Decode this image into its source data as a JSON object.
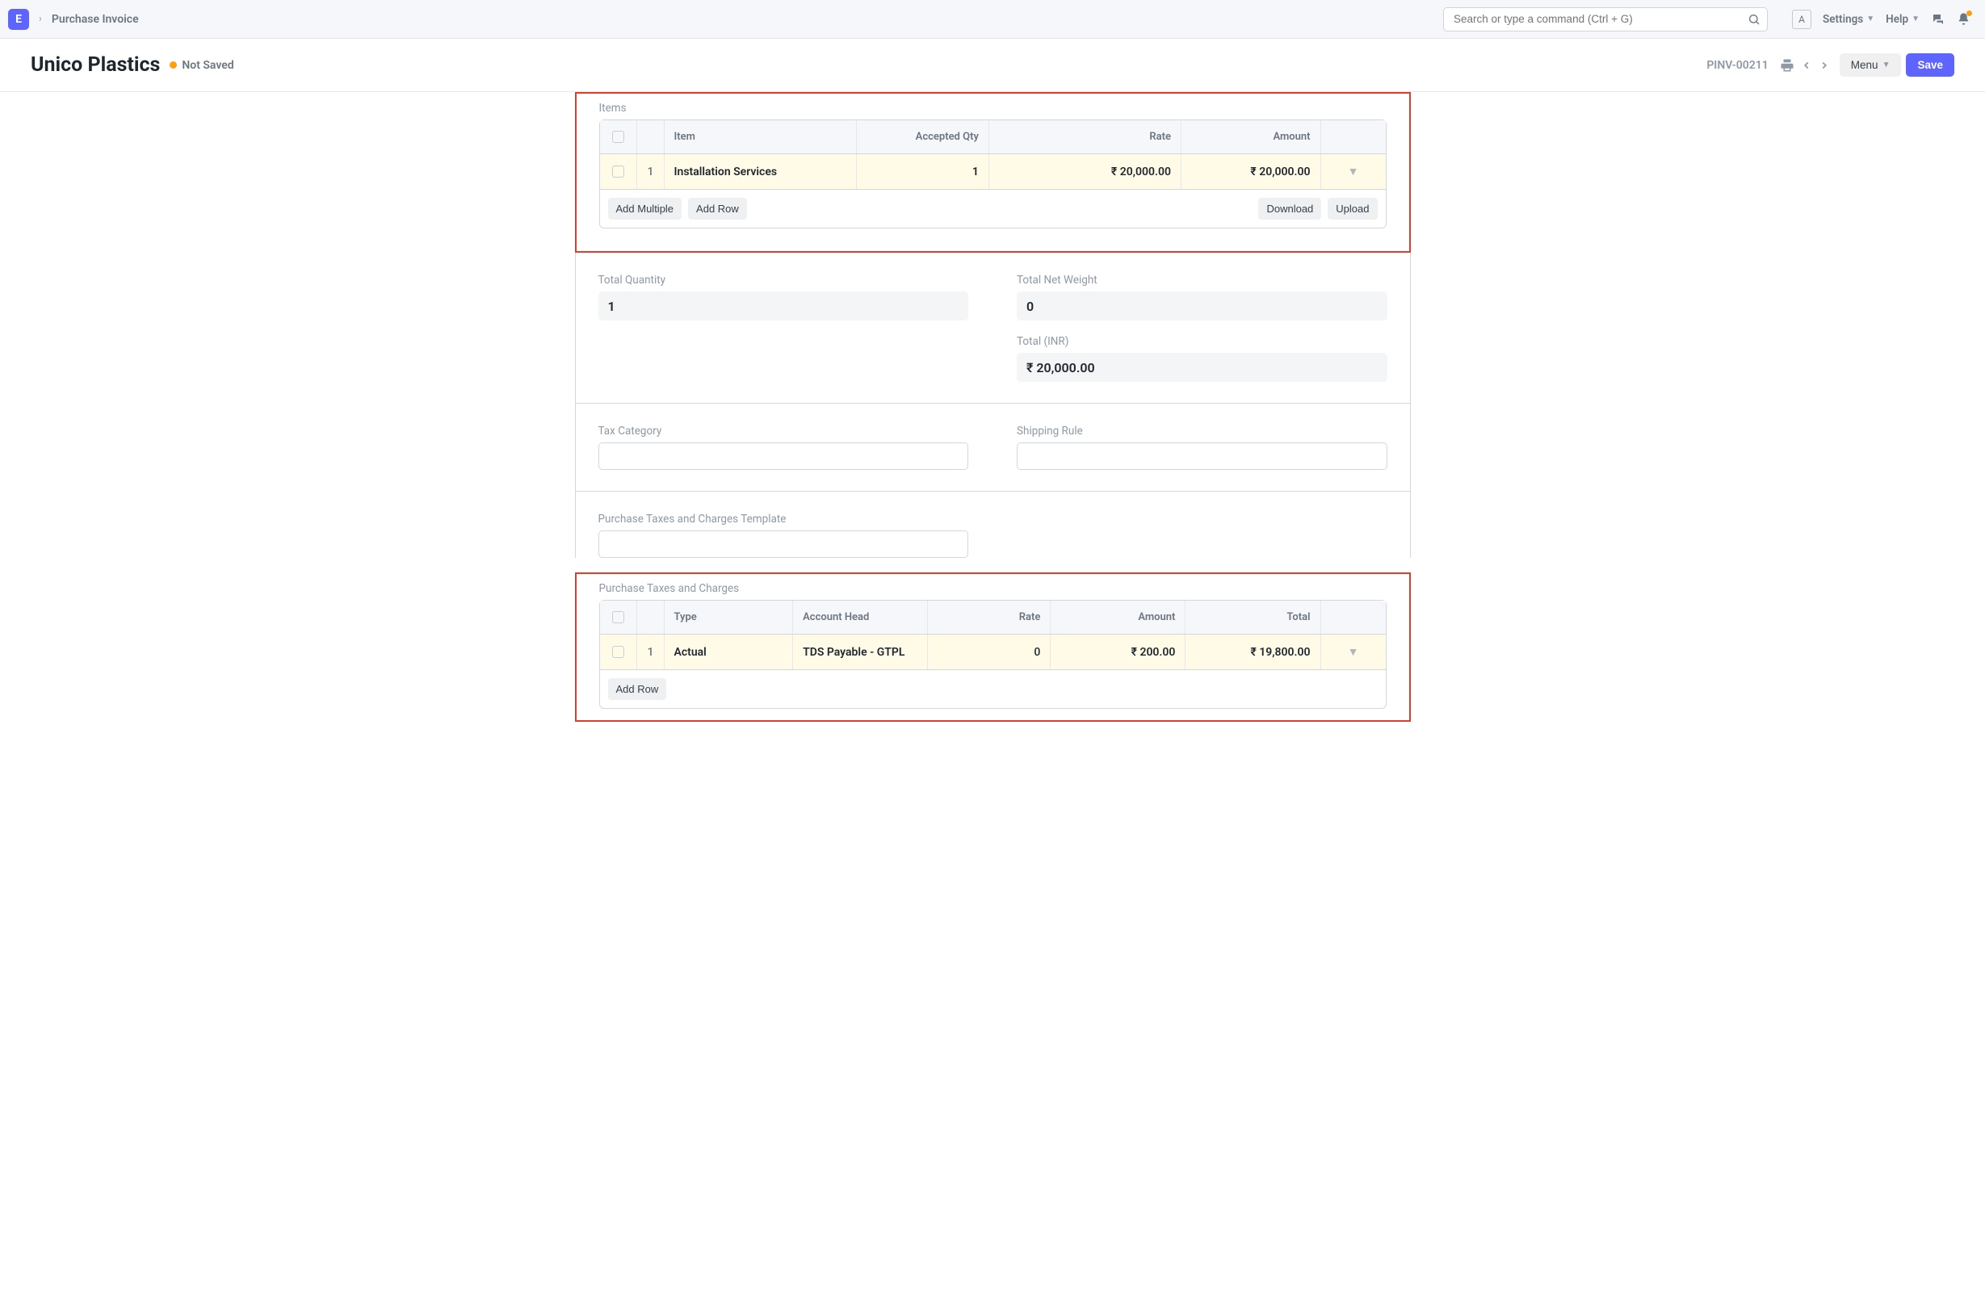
{
  "logo": "E",
  "breadcrumb": "Purchase Invoice",
  "search_placeholder": "Search or type a command (Ctrl + G)",
  "avatar_initial": "A",
  "settings_label": "Settings",
  "help_label": "Help",
  "page_title": "Unico Plastics",
  "unsaved_label": "Not Saved",
  "doc_id": "PINV-00211",
  "menu_button": "Menu",
  "save_button": "Save",
  "items_section_label": "Items",
  "items_headers": {
    "item": "Item",
    "qty": "Accepted Qty",
    "rate": "Rate",
    "amount": "Amount"
  },
  "items": [
    {
      "idx": "1",
      "item": "Installation Services",
      "qty": "1",
      "rate": "₹ 20,000.00",
      "amount": "₹ 20,000.00"
    }
  ],
  "add_multiple": "Add Multiple",
  "add_row": "Add Row",
  "download": "Download",
  "upload": "Upload",
  "totals": {
    "qty_label": "Total Quantity",
    "qty": "1",
    "net_weight_label": "Total Net Weight",
    "net_weight": "0",
    "total_label": "Total (INR)",
    "total": "₹ 20,000.00"
  },
  "tax_cat_label": "Tax Category",
  "shipping_rule_label": "Shipping Rule",
  "taxes_template_label": "Purchase Taxes and Charges Template",
  "taxes_section_label": "Purchase Taxes and Charges",
  "taxes_headers": {
    "type": "Type",
    "head": "Account Head",
    "rate": "Rate",
    "amount": "Amount",
    "total": "Total"
  },
  "taxes": [
    {
      "idx": "1",
      "type": "Actual",
      "head": "TDS Payable - GTPL",
      "rate": "0",
      "amount": "₹ 200.00",
      "total": "₹ 19,800.00"
    }
  ]
}
